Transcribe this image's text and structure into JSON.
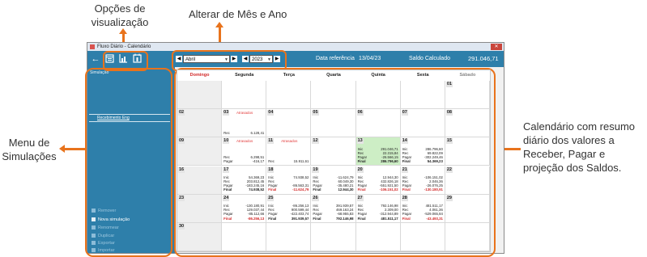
{
  "annotations": {
    "view_options_line1": "Opções de",
    "view_options_line2": "visualização",
    "change_month_year": "Alterar de Mês e Ano",
    "simulation_menu_line1": "Menu de",
    "simulation_menu_line2": "Simulações",
    "calendar_desc_line1": "Calendário com resumo",
    "calendar_desc_line2": "diário dos valores a",
    "calendar_desc_line3": "Receber, Pagar e",
    "calendar_desc_line4": "projeção dos Saldos.",
    "accent_color": "#e8731c"
  },
  "window": {
    "title": "Fluxo Diário - Calendário",
    "close_glyph": "✕"
  },
  "toolbar": {
    "back_icon": "←",
    "month": "Abril",
    "year": "2023",
    "ref_label": "Data referência",
    "ref_date": "13/04/23",
    "balance_label": "Saldo Calculado",
    "balance_value": "291.046,71",
    "prev_glyph": "◀",
    "next_glyph": "▶",
    "dropdown_glyph": "▼"
  },
  "sidebar": {
    "heading": "Simulação",
    "simulation": "Recebimento Eng",
    "new_simulation": "Nova simulação",
    "dim_items": [
      "Remover",
      "Renomear",
      "Duplicar",
      "Exportar",
      "Importar"
    ]
  },
  "calendar": {
    "weekdays": [
      "Domingo",
      "Segunda",
      "Terça",
      "Quarta",
      "Quinta",
      "Sexta",
      "Sábado"
    ],
    "late_label": "Atrasados",
    "weeks": [
      [
        {
          "day": ""
        },
        {
          "day": ""
        },
        {
          "day": ""
        },
        {
          "day": ""
        },
        {
          "day": ""
        },
        {
          "day": ""
        },
        {
          "day": "01",
          "rows": []
        }
      ],
      [
        {
          "day": "02",
          "rows": []
        },
        {
          "day": "03",
          "late": true,
          "rows": [
            {
              "l": "Rec",
              "v": "6.128,41"
            }
          ]
        },
        {
          "day": "04",
          "rows": []
        },
        {
          "day": "05",
          "rows": []
        },
        {
          "day": "06",
          "rows": []
        },
        {
          "day": "07",
          "rows": []
        },
        {
          "day": "08",
          "rows": []
        }
      ],
      [
        {
          "day": "09",
          "rows": []
        },
        {
          "day": "10",
          "late": true,
          "rows": [
            {
              "l": "Rec",
              "v": "6.298,51"
            },
            {
              "l": "Pagar",
              "v": "-416,17"
            }
          ]
        },
        {
          "day": "11",
          "late": true,
          "rows": [
            {
              "l": "Rec",
              "v": "15.911,61"
            }
          ]
        },
        {
          "day": "12",
          "rows": []
        },
        {
          "day": "13",
          "green": true,
          "rows": [
            {
              "l": "Inic",
              "v": "291.046,71"
            },
            {
              "l": "Rec",
              "v": "22.315,84"
            },
            {
              "l": "Pagar",
              "v": "-26.566,15"
            },
            {
              "l": "Final",
              "v": "286.796,60",
              "f": true
            }
          ]
        },
        {
          "day": "14",
          "rows": [
            {
              "l": "Inic",
              "v": "286.796,60"
            },
            {
              "l": "Rec",
              "v": "69.822,09"
            },
            {
              "l": "Pagar",
              "v": "-302.249,46"
            },
            {
              "l": "Final",
              "v": "54.369,23",
              "f": true
            }
          ]
        },
        {
          "day": "15",
          "rows": []
        }
      ],
      [
        {
          "day": "16",
          "rows": []
        },
        {
          "day": "17",
          "rows": [
            {
              "l": "Inic",
              "v": "54.369,23"
            },
            {
              "l": "Rec",
              "v": "203.812,45"
            },
            {
              "l": "Pagar",
              "v": "-183.245,16"
            },
            {
              "l": "Final",
              "v": "74.938,52",
              "f": true
            }
          ]
        },
        {
          "day": "18",
          "rows": [
            {
              "l": "Inic",
              "v": "74.938,52"
            },
            {
              "l": "Rec",
              "v": ""
            },
            {
              "l": "Pagar",
              "v": "-86.563,31"
            },
            {
              "l": "Final",
              "v": "-11.624,79",
              "f": true,
              "neg": true
            }
          ]
        },
        {
          "day": "19",
          "rows": [
            {
              "l": "Inic",
              "v": "-11.624,79"
            },
            {
              "l": "Rec",
              "v": "60.049,30"
            },
            {
              "l": "Pagar",
              "v": "-35.480,21"
            },
            {
              "l": "Final",
              "v": "12.944,30",
              "f": true
            }
          ]
        },
        {
          "day": "20",
          "rows": [
            {
              "l": "Inic",
              "v": "12.944,30"
            },
            {
              "l": "Rec",
              "v": "432.826,18"
            },
            {
              "l": "Pagar",
              "v": "-551.921,50"
            },
            {
              "l": "Final",
              "v": "-106.151,02",
              "f": true,
              "neg": true
            }
          ]
        },
        {
          "day": "21",
          "rows": [
            {
              "l": "Inic",
              "v": "-106.151,02"
            },
            {
              "l": "Rec",
              "v": "2.046,36"
            },
            {
              "l": "Pagar",
              "v": "-26.076,25"
            },
            {
              "l": "Final",
              "v": "-130.180,91",
              "f": true,
              "neg": true
            }
          ]
        },
        {
          "day": "22",
          "rows": []
        }
      ],
      [
        {
          "day": "23",
          "rows": []
        },
        {
          "day": "24",
          "rows": [
            {
              "l": "Inic",
              "v": "-130.180,91"
            },
            {
              "l": "Rec",
              "v": "129.037,44"
            },
            {
              "l": "Pagar",
              "v": "-85.112,66"
            },
            {
              "l": "Final",
              "v": "-86.256,13",
              "f": true,
              "neg": true
            }
          ]
        },
        {
          "day": "25",
          "rows": [
            {
              "l": "Inic",
              "v": "-86.256,13"
            },
            {
              "l": "Rec",
              "v": "900.599,44"
            },
            {
              "l": "Pagar",
              "v": "-422.403,74"
            },
            {
              "l": "Final",
              "v": "391.939,57",
              "f": true
            }
          ]
        },
        {
          "day": "26",
          "rows": [
            {
              "l": "Inic",
              "v": "391.939,57"
            },
            {
              "l": "Rec",
              "v": "469.163,24"
            },
            {
              "l": "Pagar",
              "v": "-68.955,83"
            },
            {
              "l": "Final",
              "v": "792.146,98",
              "f": true
            }
          ]
        },
        {
          "day": "27",
          "rows": [
            {
              "l": "Inic",
              "v": "792.146,98"
            },
            {
              "l": "Rec",
              "v": "2.309,00"
            },
            {
              "l": "Pagar",
              "v": "-312.944,89"
            },
            {
              "l": "Final",
              "v": "481.511,17",
              "f": true
            }
          ]
        },
        {
          "day": "28",
          "rows": [
            {
              "l": "Inic",
              "v": "481.511,17"
            },
            {
              "l": "Rec",
              "v": "4.061,36"
            },
            {
              "l": "Pagar",
              "v": "-529.065,84"
            },
            {
              "l": "Final",
              "v": "-43.493,31",
              "f": true,
              "neg": true
            }
          ]
        },
        {
          "day": "29",
          "rows": []
        }
      ],
      [
        {
          "day": "30",
          "rows": []
        },
        {
          "day": ""
        },
        {
          "day": ""
        },
        {
          "day": ""
        },
        {
          "day": ""
        },
        {
          "day": ""
        },
        {
          "day": ""
        }
      ]
    ]
  }
}
